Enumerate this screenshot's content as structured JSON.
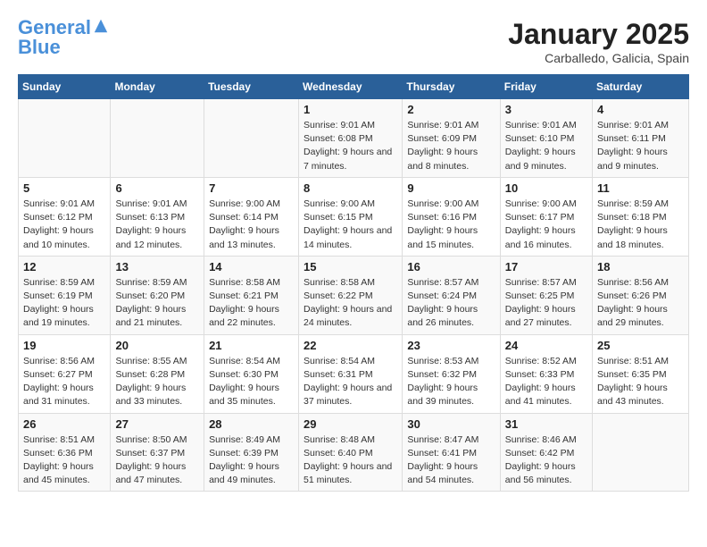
{
  "header": {
    "logo_line1": "General",
    "logo_line2": "Blue",
    "title": "January 2025",
    "subtitle": "Carballedo, Galicia, Spain"
  },
  "weekdays": [
    "Sunday",
    "Monday",
    "Tuesday",
    "Wednesday",
    "Thursday",
    "Friday",
    "Saturday"
  ],
  "weeks": [
    [
      {
        "num": "",
        "info": ""
      },
      {
        "num": "",
        "info": ""
      },
      {
        "num": "",
        "info": ""
      },
      {
        "num": "1",
        "info": "Sunrise: 9:01 AM\nSunset: 6:08 PM\nDaylight: 9 hours and 7 minutes."
      },
      {
        "num": "2",
        "info": "Sunrise: 9:01 AM\nSunset: 6:09 PM\nDaylight: 9 hours and 8 minutes."
      },
      {
        "num": "3",
        "info": "Sunrise: 9:01 AM\nSunset: 6:10 PM\nDaylight: 9 hours and 9 minutes."
      },
      {
        "num": "4",
        "info": "Sunrise: 9:01 AM\nSunset: 6:11 PM\nDaylight: 9 hours and 9 minutes."
      }
    ],
    [
      {
        "num": "5",
        "info": "Sunrise: 9:01 AM\nSunset: 6:12 PM\nDaylight: 9 hours and 10 minutes."
      },
      {
        "num": "6",
        "info": "Sunrise: 9:01 AM\nSunset: 6:13 PM\nDaylight: 9 hours and 12 minutes."
      },
      {
        "num": "7",
        "info": "Sunrise: 9:00 AM\nSunset: 6:14 PM\nDaylight: 9 hours and 13 minutes."
      },
      {
        "num": "8",
        "info": "Sunrise: 9:00 AM\nSunset: 6:15 PM\nDaylight: 9 hours and 14 minutes."
      },
      {
        "num": "9",
        "info": "Sunrise: 9:00 AM\nSunset: 6:16 PM\nDaylight: 9 hours and 15 minutes."
      },
      {
        "num": "10",
        "info": "Sunrise: 9:00 AM\nSunset: 6:17 PM\nDaylight: 9 hours and 16 minutes."
      },
      {
        "num": "11",
        "info": "Sunrise: 8:59 AM\nSunset: 6:18 PM\nDaylight: 9 hours and 18 minutes."
      }
    ],
    [
      {
        "num": "12",
        "info": "Sunrise: 8:59 AM\nSunset: 6:19 PM\nDaylight: 9 hours and 19 minutes."
      },
      {
        "num": "13",
        "info": "Sunrise: 8:59 AM\nSunset: 6:20 PM\nDaylight: 9 hours and 21 minutes."
      },
      {
        "num": "14",
        "info": "Sunrise: 8:58 AM\nSunset: 6:21 PM\nDaylight: 9 hours and 22 minutes."
      },
      {
        "num": "15",
        "info": "Sunrise: 8:58 AM\nSunset: 6:22 PM\nDaylight: 9 hours and 24 minutes."
      },
      {
        "num": "16",
        "info": "Sunrise: 8:57 AM\nSunset: 6:24 PM\nDaylight: 9 hours and 26 minutes."
      },
      {
        "num": "17",
        "info": "Sunrise: 8:57 AM\nSunset: 6:25 PM\nDaylight: 9 hours and 27 minutes."
      },
      {
        "num": "18",
        "info": "Sunrise: 8:56 AM\nSunset: 6:26 PM\nDaylight: 9 hours and 29 minutes."
      }
    ],
    [
      {
        "num": "19",
        "info": "Sunrise: 8:56 AM\nSunset: 6:27 PM\nDaylight: 9 hours and 31 minutes."
      },
      {
        "num": "20",
        "info": "Sunrise: 8:55 AM\nSunset: 6:28 PM\nDaylight: 9 hours and 33 minutes."
      },
      {
        "num": "21",
        "info": "Sunrise: 8:54 AM\nSunset: 6:30 PM\nDaylight: 9 hours and 35 minutes."
      },
      {
        "num": "22",
        "info": "Sunrise: 8:54 AM\nSunset: 6:31 PM\nDaylight: 9 hours and 37 minutes."
      },
      {
        "num": "23",
        "info": "Sunrise: 8:53 AM\nSunset: 6:32 PM\nDaylight: 9 hours and 39 minutes."
      },
      {
        "num": "24",
        "info": "Sunrise: 8:52 AM\nSunset: 6:33 PM\nDaylight: 9 hours and 41 minutes."
      },
      {
        "num": "25",
        "info": "Sunrise: 8:51 AM\nSunset: 6:35 PM\nDaylight: 9 hours and 43 minutes."
      }
    ],
    [
      {
        "num": "26",
        "info": "Sunrise: 8:51 AM\nSunset: 6:36 PM\nDaylight: 9 hours and 45 minutes."
      },
      {
        "num": "27",
        "info": "Sunrise: 8:50 AM\nSunset: 6:37 PM\nDaylight: 9 hours and 47 minutes."
      },
      {
        "num": "28",
        "info": "Sunrise: 8:49 AM\nSunset: 6:39 PM\nDaylight: 9 hours and 49 minutes."
      },
      {
        "num": "29",
        "info": "Sunrise: 8:48 AM\nSunset: 6:40 PM\nDaylight: 9 hours and 51 minutes."
      },
      {
        "num": "30",
        "info": "Sunrise: 8:47 AM\nSunset: 6:41 PM\nDaylight: 9 hours and 54 minutes."
      },
      {
        "num": "31",
        "info": "Sunrise: 8:46 AM\nSunset: 6:42 PM\nDaylight: 9 hours and 56 minutes."
      },
      {
        "num": "",
        "info": ""
      }
    ]
  ]
}
